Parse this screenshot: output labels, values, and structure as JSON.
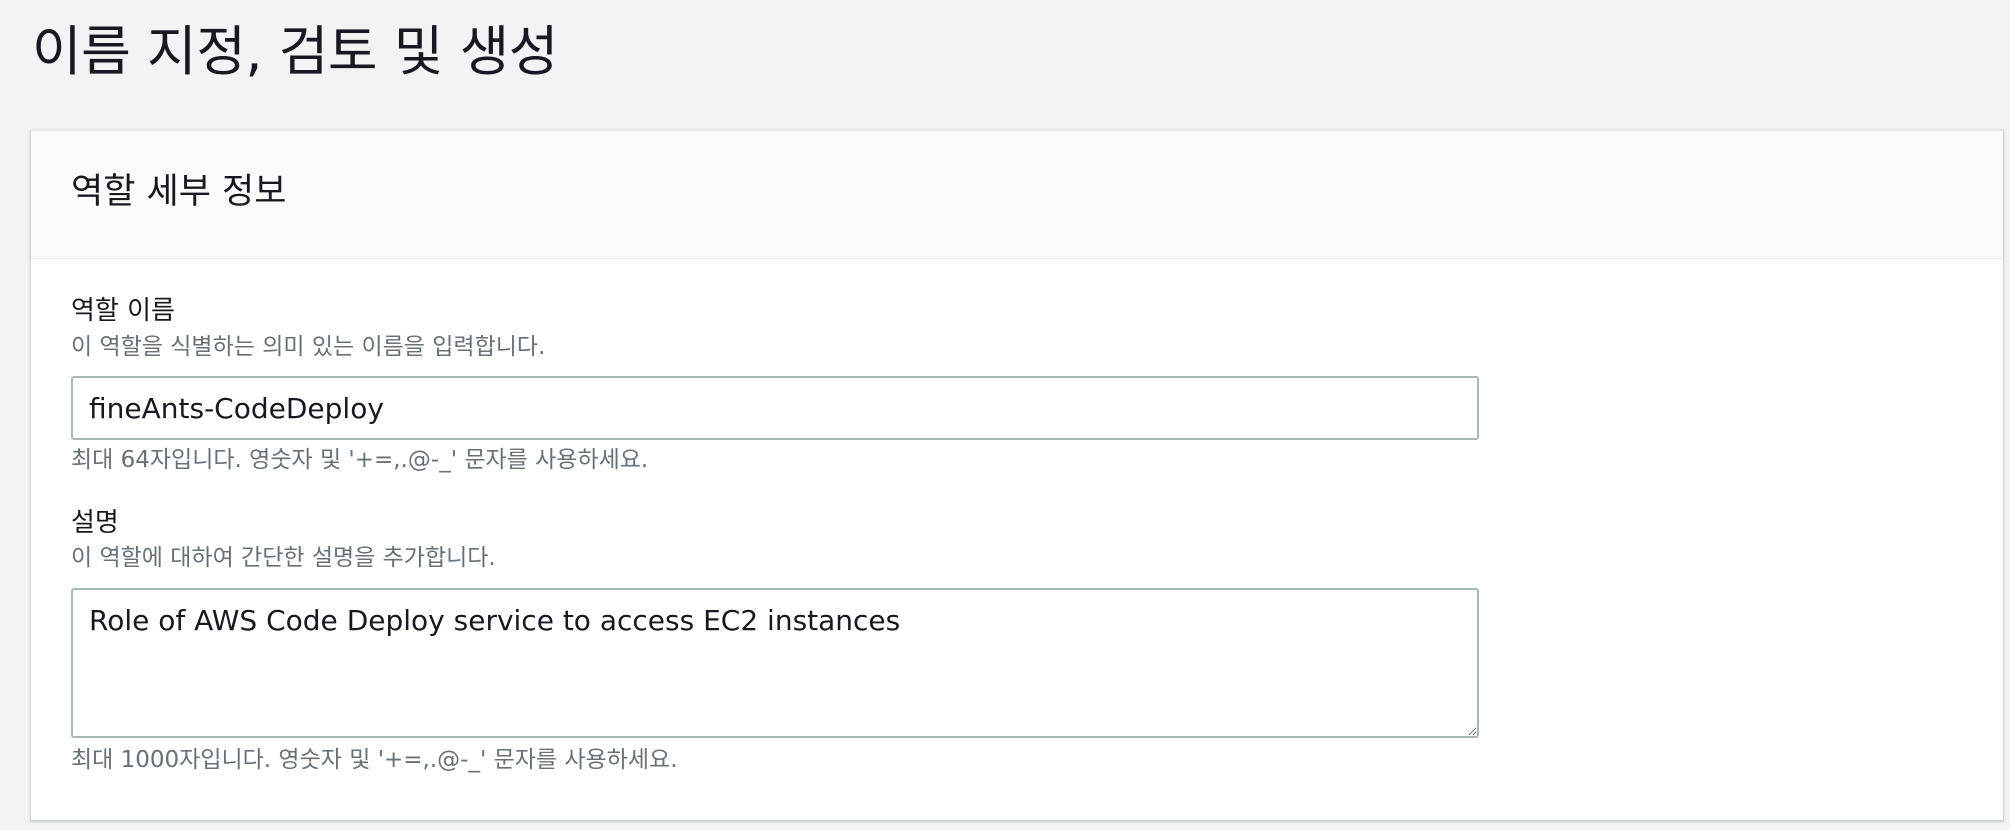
{
  "page": {
    "title": "이름 지정, 검토 및 생성"
  },
  "role_details": {
    "section_title": "역할 세부 정보",
    "role_name": {
      "label": "역할 이름",
      "description": "이 역할을 식별하는 의미 있는 이름을 입력합니다.",
      "value": "fineAnts-CodeDeploy",
      "constraint": "최대 64자입니다. 영숫자 및 '+=,.@-_' 문자를 사용하세요."
    },
    "role_description": {
      "label": "설명",
      "description": "이 역할에 대하여 간단한 설명을 추가합니다.",
      "value": "Role of AWS Code Deploy service to access EC2 instances",
      "constraint": "최대 1000자입니다. 영숫자 및 '+=,.@-_' 문자를 사용하세요."
    }
  }
}
